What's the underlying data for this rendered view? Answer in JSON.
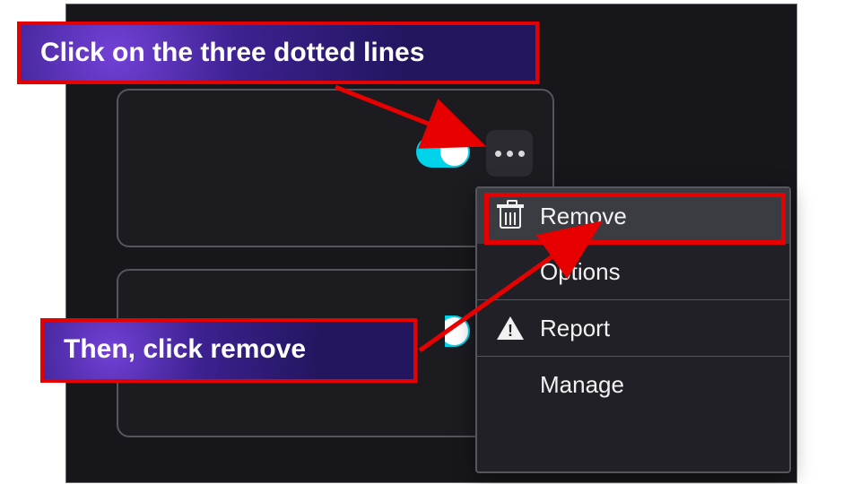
{
  "callouts": {
    "step1": "Click on the three dotted lines",
    "step2": "Then, click remove"
  },
  "menu": {
    "items": [
      {
        "label": "Remove"
      },
      {
        "label": "Options"
      },
      {
        "label": "Report"
      },
      {
        "label": "Manage"
      }
    ]
  },
  "toggles": {
    "ext1_on": true,
    "ext2_on": true
  },
  "colors": {
    "accent": "#00d2ea",
    "danger": "#e60000",
    "callout_bg": "#2a1670"
  }
}
